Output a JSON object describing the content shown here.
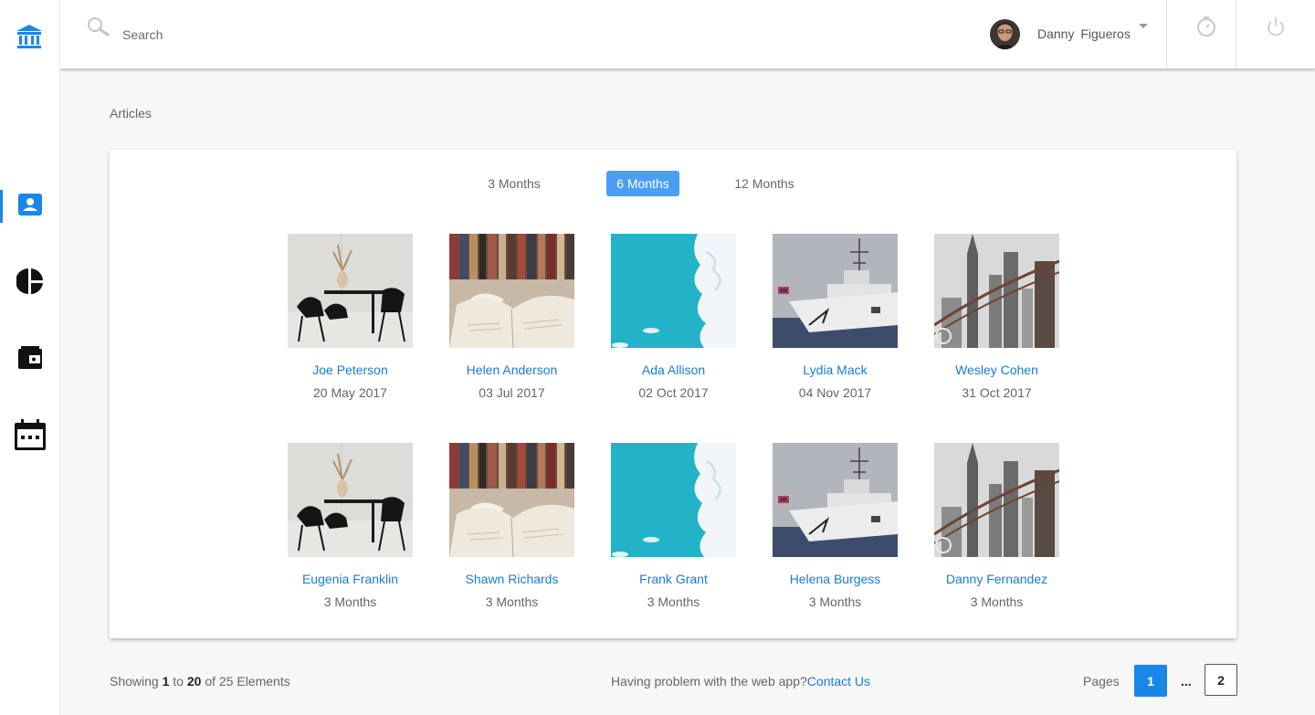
{
  "search": {
    "placeholder": "Search"
  },
  "user": {
    "name": "Danny  Figueros"
  },
  "breadcrumb": "Articles",
  "tabs": [
    {
      "label": "3 Months",
      "active": false
    },
    {
      "label": "6 Months",
      "active": true
    },
    {
      "label": "12 Months",
      "active": false
    }
  ],
  "articles": [
    {
      "name": "Joe Peterson",
      "meta": "20 May 2017",
      "image": "interior-chairs"
    },
    {
      "name": "Helen Anderson",
      "meta": "03 Jul 2017",
      "image": "open-book"
    },
    {
      "name": "Ada Allison",
      "meta": "02 Oct 2017",
      "image": "sky-clouds"
    },
    {
      "name": "Lydia Mack",
      "meta": "04 Nov 2017",
      "image": "navy-ship"
    },
    {
      "name": "Wesley Cohen",
      "meta": "31 Oct 2017",
      "image": "city-skyline"
    },
    {
      "name": "Eugenia Franklin",
      "meta": "3 Months",
      "image": "interior-chairs"
    },
    {
      "name": "Shawn Richards",
      "meta": "3 Months",
      "image": "open-book"
    },
    {
      "name": "Frank Grant",
      "meta": "3 Months",
      "image": "sky-clouds"
    },
    {
      "name": "Helena Burgess",
      "meta": "3 Months",
      "image": "navy-ship"
    },
    {
      "name": "Danny Fernandez",
      "meta": "3 Months",
      "image": "city-skyline"
    }
  ],
  "footer": {
    "showing_prefix": "Showing ",
    "from": "1",
    "to_word": " to ",
    "to": "20",
    "suffix": " of 25 Elements",
    "help_text": "Having problem with the web app?",
    "contact_label": "Contact Us",
    "pages_label": "Pages",
    "current_page": "1",
    "ellipsis": "...",
    "last_page": "2"
  },
  "colors": {
    "accent": "#1a86e8",
    "tab_active": "#4a9ff5",
    "link": "#1a7bd8"
  }
}
